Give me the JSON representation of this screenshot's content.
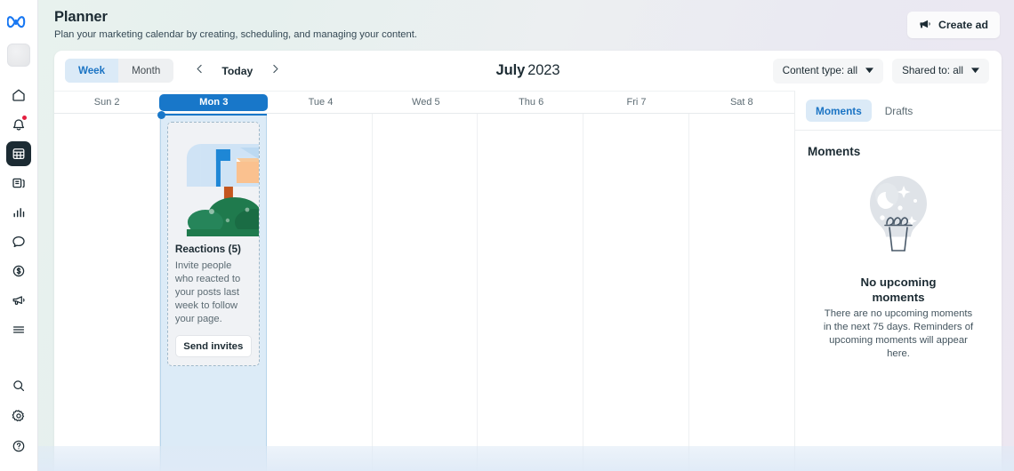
{
  "brand": {
    "logo_icon": "meta-infinity-logo",
    "accent_blue": "#1877c9",
    "tab_active_bg": "#dbeaf7",
    "tab_active_text": "#1b74c4"
  },
  "rail": {
    "avatar_label": "",
    "items": [
      {
        "icon": "home-icon",
        "name": "home",
        "active": false,
        "badge": false
      },
      {
        "icon": "bell-icon",
        "name": "notifications",
        "active": false,
        "badge": true
      },
      {
        "icon": "calendar-grid-icon",
        "name": "planner",
        "active": true,
        "badge": false
      },
      {
        "icon": "pages-icon",
        "name": "pages",
        "active": false,
        "badge": false
      },
      {
        "icon": "bar-chart-icon",
        "name": "insights",
        "active": false,
        "badge": false
      },
      {
        "icon": "chat-bubble-icon",
        "name": "inbox",
        "active": false,
        "badge": false
      },
      {
        "icon": "dollar-circle-icon",
        "name": "monetization",
        "active": false,
        "badge": false
      },
      {
        "icon": "megaphone-icon",
        "name": "ads",
        "active": false,
        "badge": false
      },
      {
        "icon": "hamburger-menu-icon",
        "name": "more",
        "active": false,
        "badge": false
      }
    ],
    "bottom_items": [
      {
        "icon": "search-icon",
        "name": "search"
      },
      {
        "icon": "gear-icon",
        "name": "settings"
      },
      {
        "icon": "help-circle-icon",
        "name": "help"
      }
    ]
  },
  "header": {
    "title": "Planner",
    "subtitle": "Plan your marketing calendar by creating, scheduling, and managing your content.",
    "create_ad_label": "Create ad",
    "create_ad_icon": "megaphone-icon"
  },
  "toolbar": {
    "view_week": "Week",
    "view_month": "Month",
    "active_view": "Week",
    "prev_icon": "chevron-left-icon",
    "next_icon": "chevron-right-icon",
    "today_label": "Today",
    "month_name": "July",
    "year": "2023",
    "filters": [
      {
        "label": "Content type: all",
        "name": "content-type-filter"
      },
      {
        "label": "Shared to: all",
        "name": "shared-to-filter"
      }
    ]
  },
  "calendar": {
    "days": [
      {
        "label": "Sun 2",
        "today": false
      },
      {
        "label": "Mon 3",
        "today": true
      },
      {
        "label": "Tue 4",
        "today": false
      },
      {
        "label": "Wed 5",
        "today": false
      },
      {
        "label": "Thu 6",
        "today": false
      },
      {
        "label": "Fri 7",
        "today": false
      },
      {
        "label": "Sat 8",
        "today": false
      }
    ],
    "event": {
      "day_index": 1,
      "illustration": "mailbox-illustration",
      "title": "Reactions (5)",
      "description": "Invite people who reacted to your posts last week to follow your page.",
      "action_label": "Send invites"
    }
  },
  "side_panel": {
    "tabs": [
      {
        "label": "Moments",
        "active": true
      },
      {
        "label": "Drafts",
        "active": false
      }
    ],
    "heading": "Moments",
    "empty": {
      "illustration": "lightbulb-night-illustration",
      "title": "No upcoming moments",
      "text": "There are no upcoming moments in the next 75 days. Reminders of upcoming moments will appear here."
    }
  }
}
